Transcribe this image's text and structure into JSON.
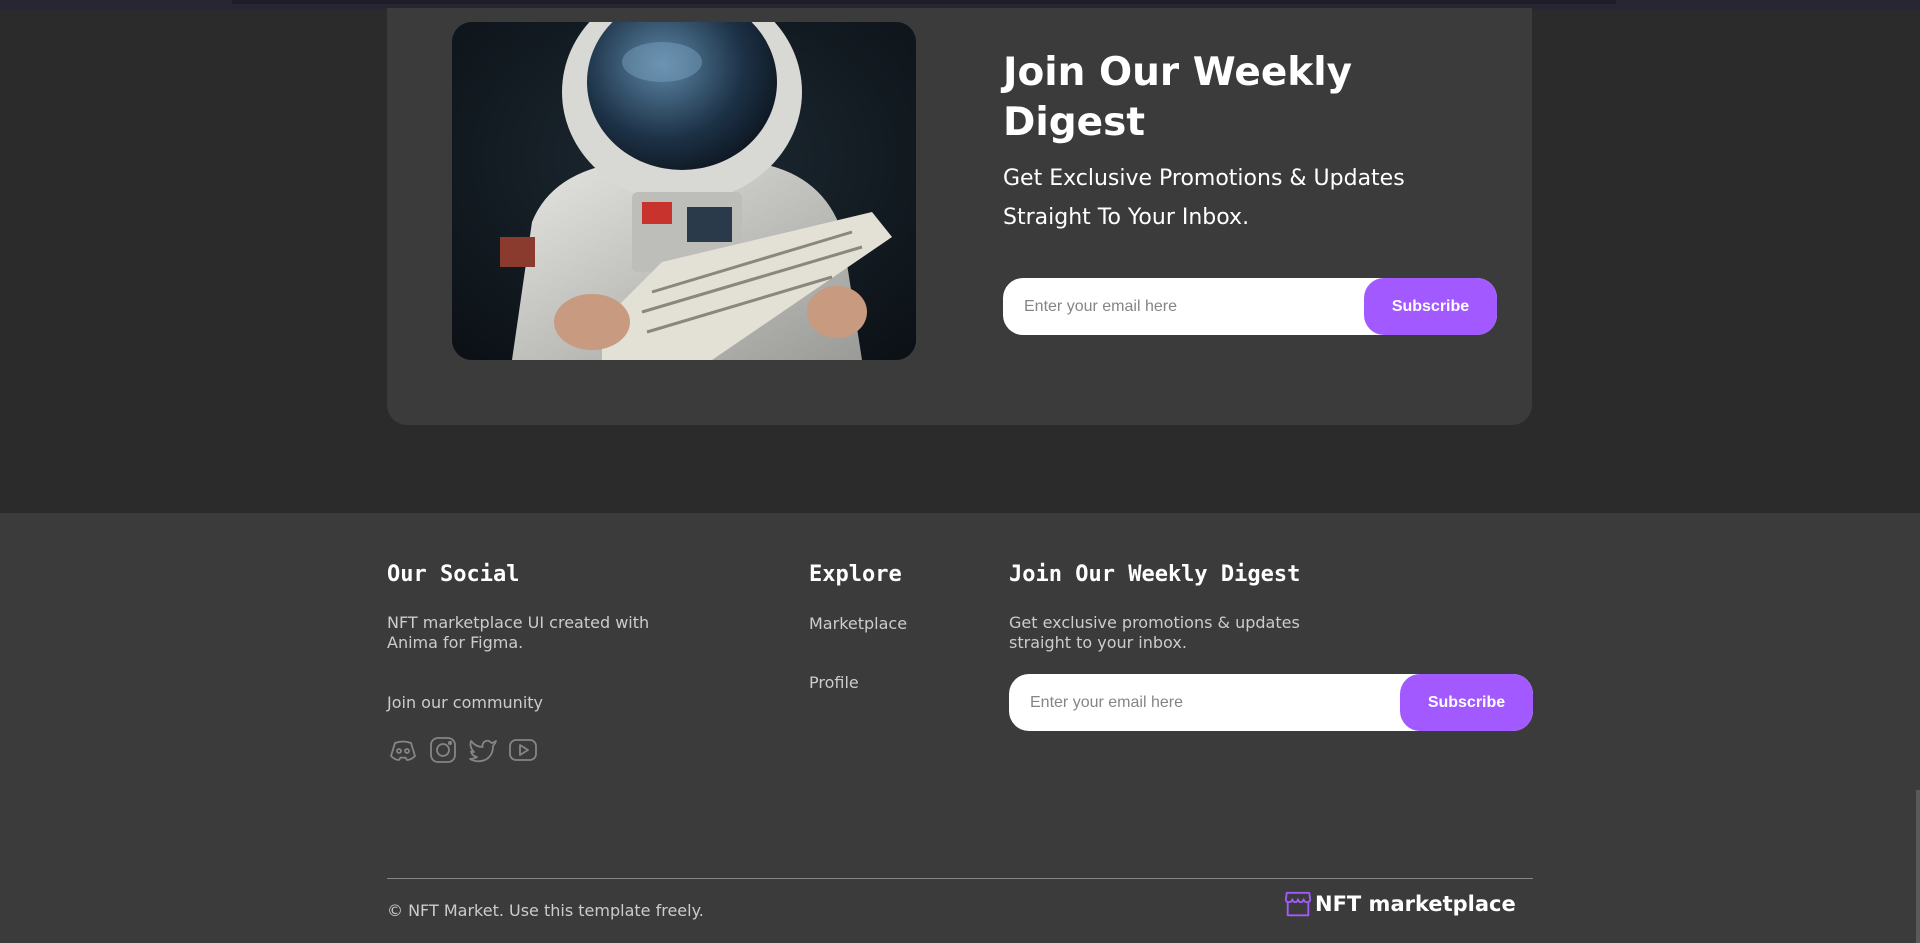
{
  "newsletter": {
    "title": "Join Our Weekly Digest",
    "subtitle": "Get Exclusive Promotions & Updates Straight To Your Inbox.",
    "email_placeholder": "Enter your email here",
    "subscribe_label": "Subscribe",
    "image_alt": "astronaut-reading-newspaper"
  },
  "footer": {
    "social": {
      "heading": "Our Social",
      "description": "NFT marketplace UI created with Anima for Figma.",
      "community_label": "Join our community",
      "icons": [
        "discord-icon",
        "instagram-icon",
        "twitter-icon",
        "youtube-icon"
      ]
    },
    "explore": {
      "heading": "Explore",
      "links": [
        "Marketplace",
        "Profile"
      ]
    },
    "digest": {
      "heading": "Join Our Weekly Digest",
      "description": "Get exclusive promotions & updates straight to your inbox.",
      "email_placeholder": "Enter your email here",
      "subscribe_label": "Subscribe"
    },
    "copyright": "© NFT Market. Use this template freely.",
    "brand_name": "NFT marketplace",
    "brand_icon": "storefront-icon"
  },
  "colors": {
    "accent": "#a259ff",
    "background_dark": "#2b2b2b",
    "background_card": "#3b3b3b",
    "text_muted": "#cccccc",
    "divider": "#858584"
  }
}
